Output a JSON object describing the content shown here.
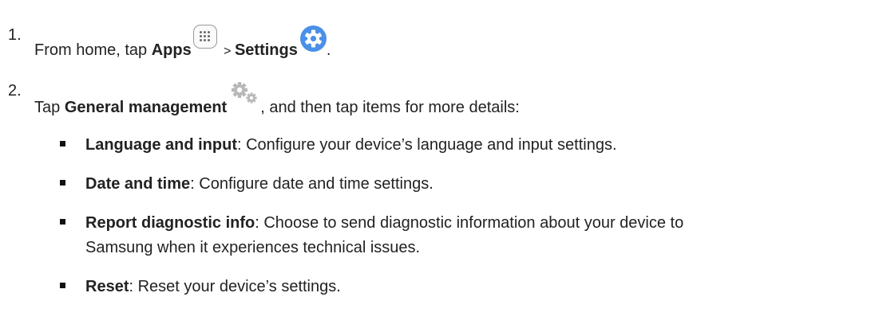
{
  "step1": {
    "number": "1.",
    "prefix": "From home, tap ",
    "apps": "Apps",
    "separator": " > ",
    "settings": "Settings",
    "suffix": ".",
    "icons": [
      "apps-grid-icon",
      "settings-gear-icon"
    ]
  },
  "step2": {
    "number": "2.",
    "prefix": "Tap ",
    "general": "General management",
    "suffix": ", and then tap items for more details:",
    "icon": "general-management-gears-icon"
  },
  "items": [
    {
      "term": "Language and input",
      "desc": ": Configure your device’s language and input settings."
    },
    {
      "term": "Date and time",
      "desc": ": Configure date and time settings."
    },
    {
      "term": "Report diagnostic info",
      "desc": ": Choose to send diagnostic information about your device to",
      "desc_cont": "Samsung when it experiences technical issues."
    },
    {
      "term": "Reset",
      "desc": ": Reset your device’s settings."
    }
  ],
  "colors": {
    "text": "#222222",
    "settings_icon": "#4a90e8",
    "gear_icon": "#b8b8b8"
  }
}
